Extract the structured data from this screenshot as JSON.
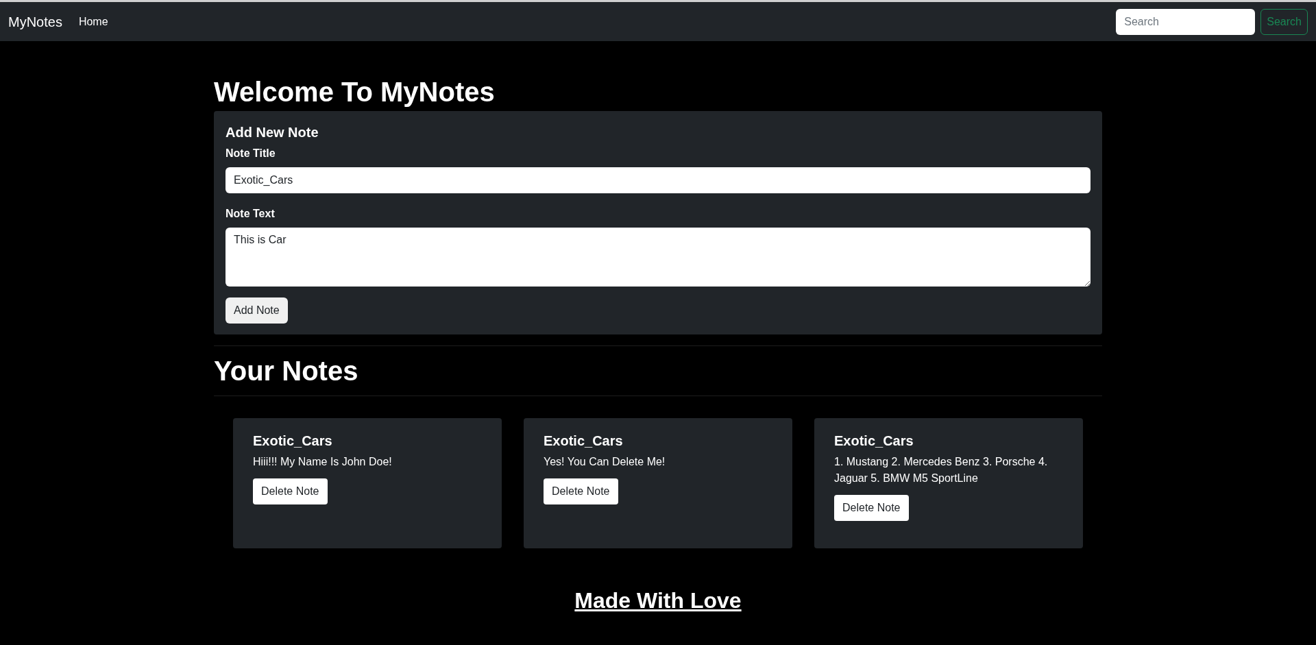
{
  "navbar": {
    "brand": "MyNotes",
    "links": [
      {
        "label": "Home",
        "selected": true
      }
    ],
    "search": {
      "placeholder": "Search",
      "button": "Search"
    }
  },
  "heading": "Welcome To MyNotes",
  "add_note": {
    "title": "Add New Note",
    "title_label": "Note Title",
    "title_value": "Exotic_Cars",
    "text_label": "Note Text",
    "text_value": "This is Car",
    "button": "Add Note"
  },
  "notes_heading": "Your Notes",
  "notes": [
    {
      "title": "Exotic_Cars",
      "text": "Hiii!!! My Name Is John Doe!",
      "button": "Delete Note"
    },
    {
      "title": "Exotic_Cars",
      "text": "Yes! You Can Delete Me!",
      "button": "Delete Note"
    },
    {
      "title": "Exotic_Cars",
      "text": "1. Mustang 2. Mercedes Benz 3. Porsche 4. Jaguar 5. BMW M5 SportLine",
      "button": "Delete Note"
    }
  ],
  "footer": "Made With Love"
}
